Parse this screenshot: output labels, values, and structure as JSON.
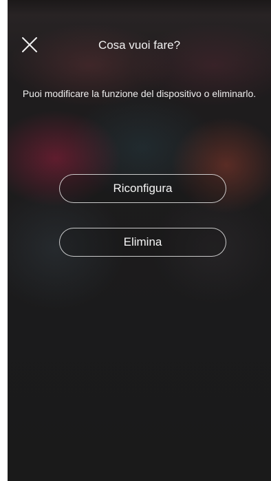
{
  "header": {
    "close_icon": "close-icon",
    "title": "Cosa vuoi fare?"
  },
  "main": {
    "description": "Puoi modificare la funzione del dispositivo o eliminarlo.",
    "actions": {
      "reconfigure_label": "Riconfigura",
      "delete_label": "Elimina"
    }
  },
  "colors": {
    "background": "#1b1b1c",
    "text": "#f2f2f2",
    "button_border": "#ebebeb"
  }
}
